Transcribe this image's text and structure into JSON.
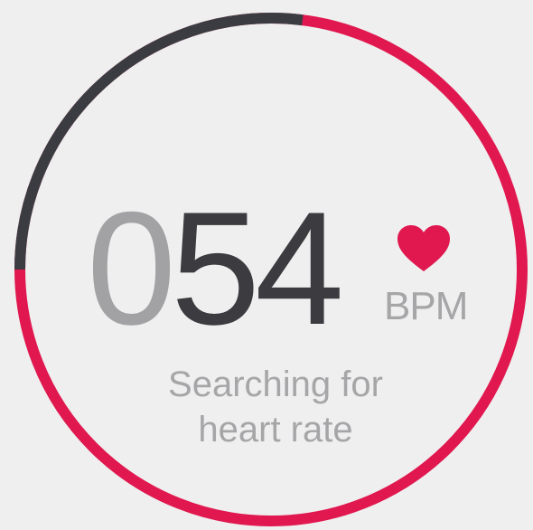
{
  "reading": {
    "leading_digit": "0",
    "value_digits": "54",
    "unit": "BPM"
  },
  "status": {
    "line1": "Searching for",
    "line2": "heart rate"
  },
  "ring": {
    "dark_fraction": 0.27,
    "color_dark": "#3b3c42",
    "color_accent": "#e0184f"
  },
  "icons": {
    "heart": "heart-icon"
  }
}
